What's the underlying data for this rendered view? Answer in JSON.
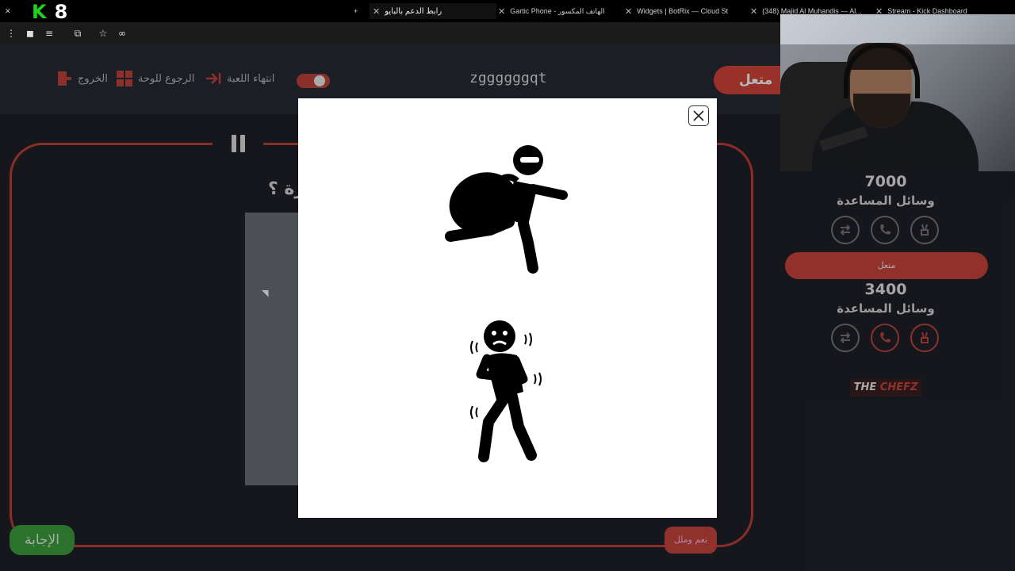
{
  "browser": {
    "tabs": [
      {
        "title": "رابط الدعم بالبايو",
        "active": true
      },
      {
        "title": "Gartic Phone - الهاتف المكسور"
      },
      {
        "title": "Widgets | BotRix — Cloud Stre"
      },
      {
        "title": "(348) Majid Al Muhandis — Al..."
      },
      {
        "title": "Stream - Kick Dashboard"
      }
    ],
    "overlay_logo": {
      "k": "K",
      "n": "8"
    },
    "bar_icons": [
      "menu-icon",
      "profile-icon",
      "playlist-icon",
      "extensions-icon",
      "star-icon",
      "glasses-icon"
    ]
  },
  "game": {
    "nav": {
      "exit_label": "الخروج",
      "back_label": "الرجوع للوحة",
      "end_label": "انتهاء اللعبة"
    },
    "player_name": "zggggggqt",
    "top_button_label": "متعل",
    "question_text": "رة ؟",
    "answer_label": "الإجابة",
    "yes_label": "نعم وملل"
  },
  "teams": [
    {
      "score": "7000",
      "label": "وسائل المساعدة",
      "name_button": ""
    },
    {
      "score": "3400",
      "label": "وسائل المساعدة",
      "name_button": "متعل"
    }
  ],
  "sponsor": {
    "the": "THE",
    "name": "CHEFZ"
  },
  "modal": {
    "icons": [
      "thief-running-with-bag-icon",
      "scared-trembling-person-icon"
    ]
  },
  "colors": {
    "accent_red": "#c9443a",
    "bg": "#1e2129",
    "green": "#3e9e3e"
  }
}
